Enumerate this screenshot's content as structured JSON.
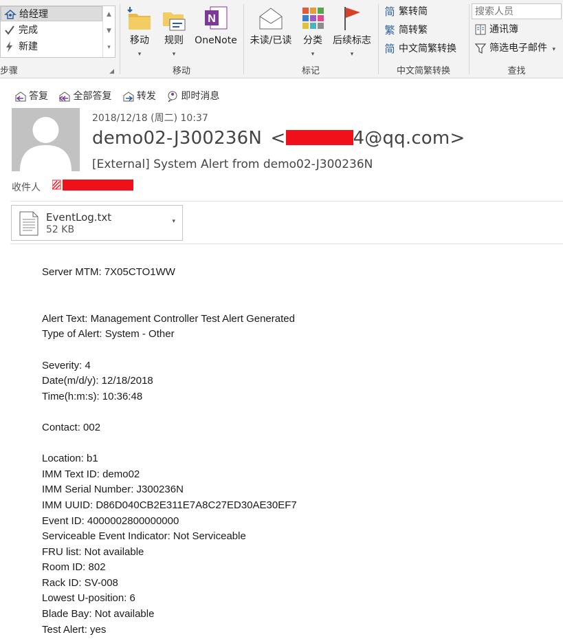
{
  "ribbon": {
    "steps": {
      "items": [
        {
          "label": "给经理",
          "icon": "manager-icon",
          "selected": true
        },
        {
          "label": "完成",
          "icon": "checkmark-icon",
          "selected": false
        },
        {
          "label": "新建",
          "icon": "lightning-icon",
          "selected": false
        }
      ],
      "group_label": "步骤"
    },
    "move": {
      "move_label": "移动",
      "rules_label": "规则",
      "onenote_label": "OneNote",
      "group_label": "移动"
    },
    "tags": {
      "unread_label": "未读/已读",
      "categorize_label": "分类",
      "followup_label": "后续标志",
      "group_label": "标记"
    },
    "chinese": {
      "to_simplified": "繁转简",
      "to_traditional": "简转繁",
      "convert": "中文简繁转换",
      "group_label": "中文简繁转换"
    },
    "find": {
      "search_placeholder": "搜索人员",
      "address_book": "通讯簿",
      "filter_email": "筛选电子邮件",
      "group_label": "查找"
    }
  },
  "message": {
    "actions": {
      "reply": "答复",
      "reply_all": "全部答复",
      "forward": "转发",
      "im": "即时消息"
    },
    "date": "2018/12/18 (周二) 10:37",
    "sender_name": "demo02-J300236N",
    "sender_email_prefix": "<",
    "sender_email_suffix": "4@qq.com>",
    "subject": "[External]  System Alert from demo02-J300236N",
    "to_label": "收件人",
    "attachment": {
      "name": "EventLog.txt",
      "size": "52 KB"
    },
    "body_lines": [
      "Server MTM: 7X05CTO1WW",
      "",
      "",
      "Alert Text: Management Controller Test Alert Generated",
      "Type of Alert: System - Other",
      "",
      "Severity: 4",
      "Date(m/d/y): 12/18/2018",
      "Time(h:m:s): 10:36:48",
      "",
      "Contact: 002",
      "",
      "Location: b1",
      "IMM Text ID: demo02",
      "IMM Serial Number: J300236N",
      "IMM UUID: D86D040CB2E311E7A8C27ED30AE30EF7",
      "Event ID: 4000002800000000",
      "Serviceable Event Indicator: Not Serviceable",
      "FRU list: Not available",
      "Room ID: 802",
      "Rack ID: SV-008",
      "Lowest U-position: 6",
      "Blade Bay: Not available",
      "Test Alert: yes"
    ]
  },
  "colors": {
    "redaction": "#f0101a",
    "onenote": "#7b3a96",
    "flag": "#d9402b",
    "accent_blue": "#2a5d9a"
  }
}
